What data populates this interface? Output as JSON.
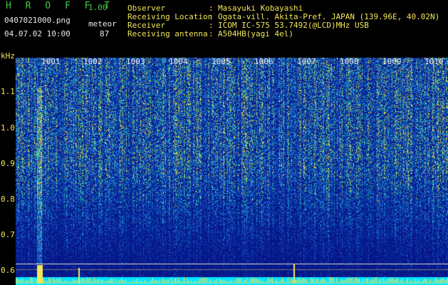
{
  "header": {
    "app_title": "H R O F F T",
    "version": "1.00",
    "filename": "0407021000.png",
    "datetime": "04.07.02 10:00",
    "meteor_label": "meteor",
    "meteor_count": "87"
  },
  "info": [
    {
      "key": "Observer",
      "value": "Masayuki Kobayashi"
    },
    {
      "key": "Receiving Location",
      "value": "Ogata-vill. Akita-Pref. JAPAN (139.96E, 40.02N)"
    },
    {
      "key": "Receiver",
      "value": "ICOM IC-575 53.7492(@LCD)MHz USB"
    },
    {
      "key": "Receiving antenna",
      "value": "A504HB(yagi 4el)"
    }
  ],
  "separator": ":",
  "axis": {
    "unit": "kHz",
    "freq_ticks": [
      "1.1",
      "1.0",
      "0.9",
      "0.8",
      "0.7",
      "0.6"
    ],
    "time_ticks": [
      "1001",
      "1002",
      "1003",
      "1004",
      "1005",
      "1006",
      "1007",
      "1008",
      "1009",
      "1010"
    ]
  },
  "colors": {
    "green_text": "#5fd84a",
    "white_text": "#e8e8e8",
    "yellow_text": "#f2e65a",
    "spectrogram_bg": "#0a1a8c",
    "baseline": "#00e5ff"
  }
}
